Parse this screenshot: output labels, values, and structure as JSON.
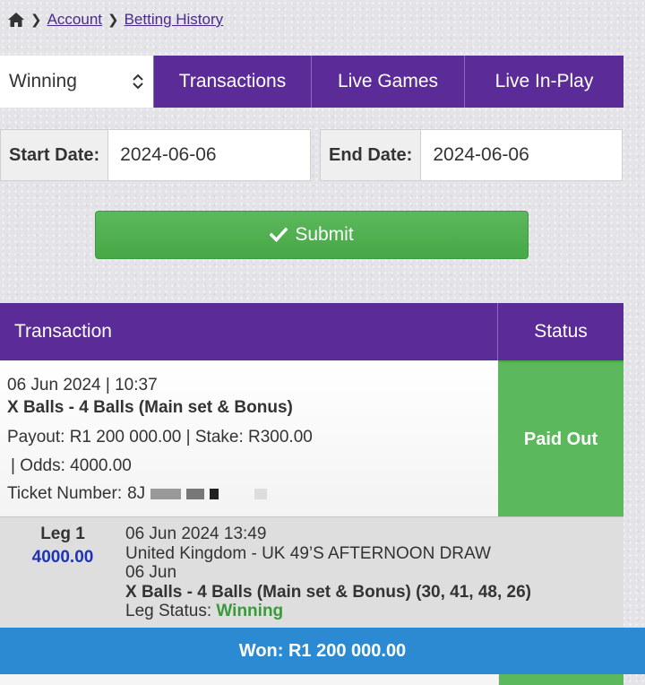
{
  "breadcrumb": {
    "home_icon": "home-icon",
    "account": "Account",
    "history": "Betting History"
  },
  "filter": {
    "selected": "Winning",
    "tabs": [
      "Transactions",
      "Live Games",
      "Live In-Play"
    ]
  },
  "dates": {
    "start_label": "Start Date:",
    "start_value": "2024-06-06",
    "end_label": "End Date:",
    "end_value": "2024-06-06"
  },
  "submit_label": "Submit",
  "table": {
    "col_transaction": "Transaction",
    "col_status": "Status",
    "row": {
      "datetime": "06 Jun 2024 | 10:37",
      "game": "X Balls - 4 Balls (Main set & Bonus)",
      "payout_stake": "Payout: R1 200 000.00 | Stake: R300.00",
      "odds": "| Odds: 4000.00",
      "ticket_label": "Ticket Number:",
      "ticket_visible": "8J",
      "status": "Paid Out"
    },
    "leg": {
      "label": "Leg 1",
      "odds": "4000.00",
      "datetime": "06 Jun 2024 13:49",
      "event": "United Kingdom - UK 49’S AFTERNOON DRAW",
      "event_date": "06 Jun",
      "selection": "X Balls - 4 Balls (Main set & Bonus) (30, 41, 48, 26)",
      "status_label": "Leg Status:",
      "status_value": "Winning"
    }
  },
  "won": "Won: R1 200 000.00",
  "colors": {
    "purple": "#5b2c98",
    "green": "#5cb85c",
    "blue_bar": "#2b8ad2",
    "odds_blue": "#1d33b8"
  }
}
